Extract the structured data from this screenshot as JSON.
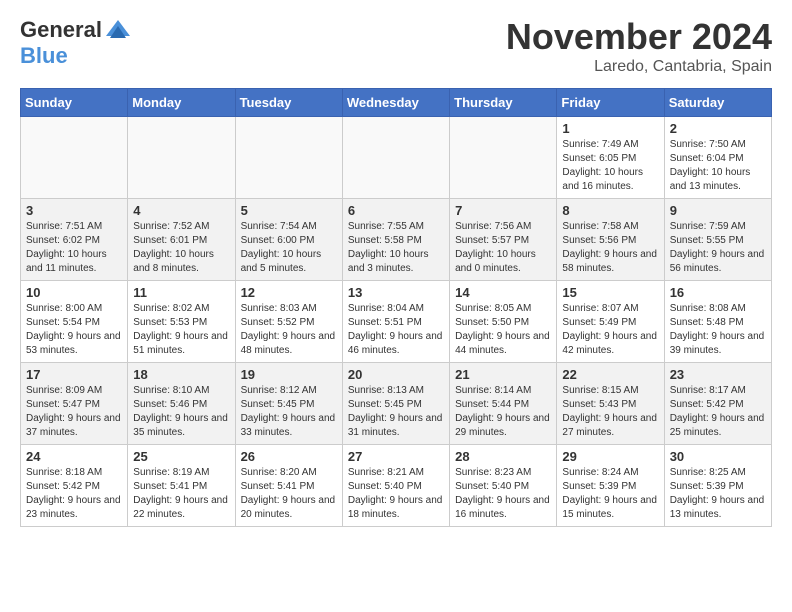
{
  "header": {
    "logo_line1": "General",
    "logo_line2": "Blue",
    "month": "November 2024",
    "location": "Laredo, Cantabria, Spain"
  },
  "weekdays": [
    "Sunday",
    "Monday",
    "Tuesday",
    "Wednesday",
    "Thursday",
    "Friday",
    "Saturday"
  ],
  "weeks": [
    [
      {
        "day": "",
        "info": ""
      },
      {
        "day": "",
        "info": ""
      },
      {
        "day": "",
        "info": ""
      },
      {
        "day": "",
        "info": ""
      },
      {
        "day": "",
        "info": ""
      },
      {
        "day": "1",
        "info": "Sunrise: 7:49 AM\nSunset: 6:05 PM\nDaylight: 10 hours and 16 minutes."
      },
      {
        "day": "2",
        "info": "Sunrise: 7:50 AM\nSunset: 6:04 PM\nDaylight: 10 hours and 13 minutes."
      }
    ],
    [
      {
        "day": "3",
        "info": "Sunrise: 7:51 AM\nSunset: 6:02 PM\nDaylight: 10 hours and 11 minutes."
      },
      {
        "day": "4",
        "info": "Sunrise: 7:52 AM\nSunset: 6:01 PM\nDaylight: 10 hours and 8 minutes."
      },
      {
        "day": "5",
        "info": "Sunrise: 7:54 AM\nSunset: 6:00 PM\nDaylight: 10 hours and 5 minutes."
      },
      {
        "day": "6",
        "info": "Sunrise: 7:55 AM\nSunset: 5:58 PM\nDaylight: 10 hours and 3 minutes."
      },
      {
        "day": "7",
        "info": "Sunrise: 7:56 AM\nSunset: 5:57 PM\nDaylight: 10 hours and 0 minutes."
      },
      {
        "day": "8",
        "info": "Sunrise: 7:58 AM\nSunset: 5:56 PM\nDaylight: 9 hours and 58 minutes."
      },
      {
        "day": "9",
        "info": "Sunrise: 7:59 AM\nSunset: 5:55 PM\nDaylight: 9 hours and 56 minutes."
      }
    ],
    [
      {
        "day": "10",
        "info": "Sunrise: 8:00 AM\nSunset: 5:54 PM\nDaylight: 9 hours and 53 minutes."
      },
      {
        "day": "11",
        "info": "Sunrise: 8:02 AM\nSunset: 5:53 PM\nDaylight: 9 hours and 51 minutes."
      },
      {
        "day": "12",
        "info": "Sunrise: 8:03 AM\nSunset: 5:52 PM\nDaylight: 9 hours and 48 minutes."
      },
      {
        "day": "13",
        "info": "Sunrise: 8:04 AM\nSunset: 5:51 PM\nDaylight: 9 hours and 46 minutes."
      },
      {
        "day": "14",
        "info": "Sunrise: 8:05 AM\nSunset: 5:50 PM\nDaylight: 9 hours and 44 minutes."
      },
      {
        "day": "15",
        "info": "Sunrise: 8:07 AM\nSunset: 5:49 PM\nDaylight: 9 hours and 42 minutes."
      },
      {
        "day": "16",
        "info": "Sunrise: 8:08 AM\nSunset: 5:48 PM\nDaylight: 9 hours and 39 minutes."
      }
    ],
    [
      {
        "day": "17",
        "info": "Sunrise: 8:09 AM\nSunset: 5:47 PM\nDaylight: 9 hours and 37 minutes."
      },
      {
        "day": "18",
        "info": "Sunrise: 8:10 AM\nSunset: 5:46 PM\nDaylight: 9 hours and 35 minutes."
      },
      {
        "day": "19",
        "info": "Sunrise: 8:12 AM\nSunset: 5:45 PM\nDaylight: 9 hours and 33 minutes."
      },
      {
        "day": "20",
        "info": "Sunrise: 8:13 AM\nSunset: 5:45 PM\nDaylight: 9 hours and 31 minutes."
      },
      {
        "day": "21",
        "info": "Sunrise: 8:14 AM\nSunset: 5:44 PM\nDaylight: 9 hours and 29 minutes."
      },
      {
        "day": "22",
        "info": "Sunrise: 8:15 AM\nSunset: 5:43 PM\nDaylight: 9 hours and 27 minutes."
      },
      {
        "day": "23",
        "info": "Sunrise: 8:17 AM\nSunset: 5:42 PM\nDaylight: 9 hours and 25 minutes."
      }
    ],
    [
      {
        "day": "24",
        "info": "Sunrise: 8:18 AM\nSunset: 5:42 PM\nDaylight: 9 hours and 23 minutes."
      },
      {
        "day": "25",
        "info": "Sunrise: 8:19 AM\nSunset: 5:41 PM\nDaylight: 9 hours and 22 minutes."
      },
      {
        "day": "26",
        "info": "Sunrise: 8:20 AM\nSunset: 5:41 PM\nDaylight: 9 hours and 20 minutes."
      },
      {
        "day": "27",
        "info": "Sunrise: 8:21 AM\nSunset: 5:40 PM\nDaylight: 9 hours and 18 minutes."
      },
      {
        "day": "28",
        "info": "Sunrise: 8:23 AM\nSunset: 5:40 PM\nDaylight: 9 hours and 16 minutes."
      },
      {
        "day": "29",
        "info": "Sunrise: 8:24 AM\nSunset: 5:39 PM\nDaylight: 9 hours and 15 minutes."
      },
      {
        "day": "30",
        "info": "Sunrise: 8:25 AM\nSunset: 5:39 PM\nDaylight: 9 hours and 13 minutes."
      }
    ]
  ]
}
